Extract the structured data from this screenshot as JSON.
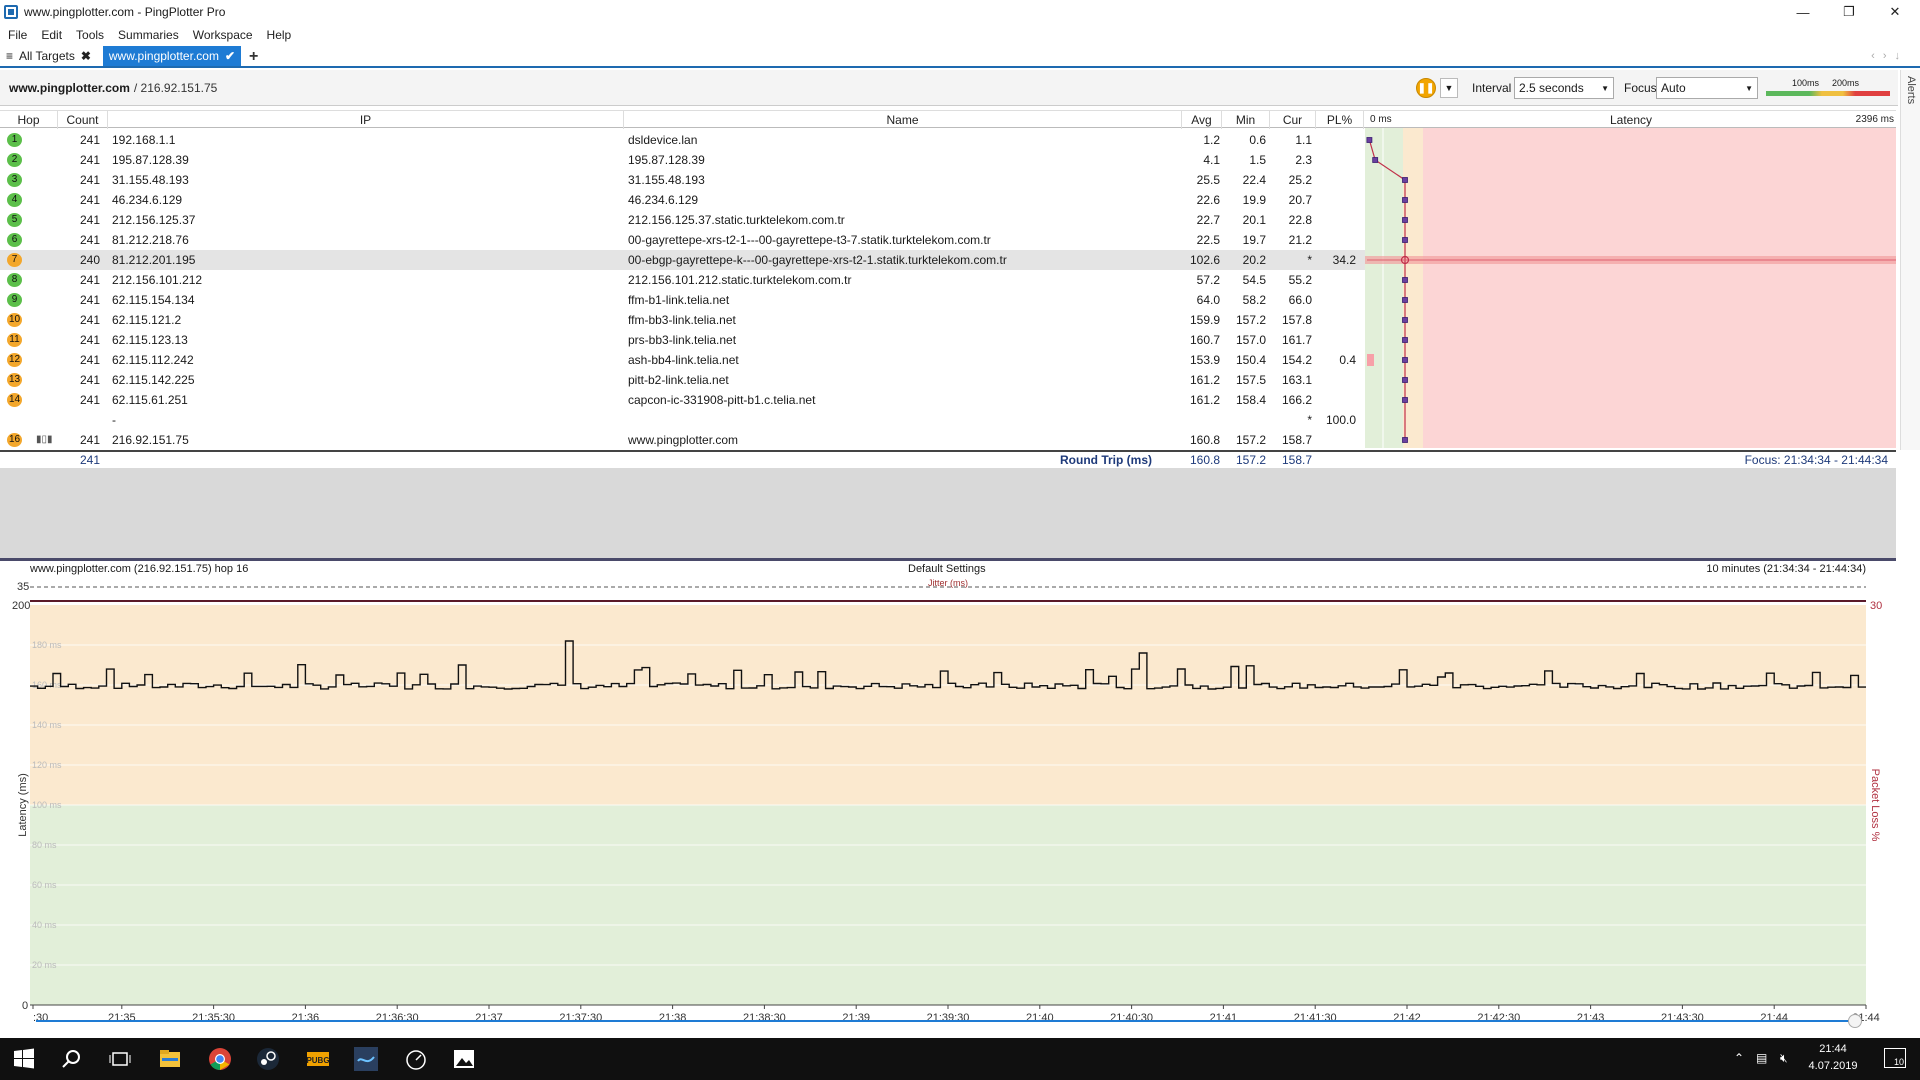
{
  "window": {
    "title": "www.pingplotter.com - PingPlotter Pro"
  },
  "menu": [
    "File",
    "Edit",
    "Tools",
    "Summaries",
    "Workspace",
    "Help"
  ],
  "tabs": {
    "all_targets": "All Targets",
    "active": "www.pingplotter.com"
  },
  "alerts": "Alerts",
  "target": {
    "host": "www.pingplotter.com",
    "ip": " / 216.92.151.75"
  },
  "toolbar": {
    "interval_label": "Interval",
    "interval_value": "2.5 seconds",
    "focus_label": "Focus",
    "focus_value": "Auto",
    "scale_100": "100ms",
    "scale_200": "200ms"
  },
  "grid": {
    "headers": {
      "hop": "Hop",
      "count": "Count",
      "ip": "IP",
      "name": "Name",
      "avg": "Avg",
      "min": "Min",
      "cur": "Cur",
      "pl": "PL%",
      "zero": "0 ms",
      "latency": "Latency",
      "max": "2396 ms"
    },
    "rows": [
      {
        "hop": "1",
        "count": "241",
        "ip": "192.168.1.1",
        "name": "dsldevice.lan",
        "avg": "1.2",
        "min": "0.6",
        "cur": "1.1",
        "pl": "",
        "color": "green",
        "lat": 1.2
      },
      {
        "hop": "2",
        "count": "241",
        "ip": "195.87.128.39",
        "name": "195.87.128.39",
        "avg": "4.1",
        "min": "1.5",
        "cur": "2.3",
        "pl": "",
        "color": "green",
        "lat": 4.1
      },
      {
        "hop": "3",
        "count": "241",
        "ip": "31.155.48.193",
        "name": "31.155.48.193",
        "avg": "25.5",
        "min": "22.4",
        "cur": "25.2",
        "pl": "",
        "color": "green",
        "lat": 25.5
      },
      {
        "hop": "4",
        "count": "241",
        "ip": "46.234.6.129",
        "name": "46.234.6.129",
        "avg": "22.6",
        "min": "19.9",
        "cur": "20.7",
        "pl": "",
        "color": "green",
        "lat": 22.6
      },
      {
        "hop": "5",
        "count": "241",
        "ip": "212.156.125.37",
        "name": "212.156.125.37.static.turktelekom.com.tr",
        "avg": "22.7",
        "min": "20.1",
        "cur": "22.8",
        "pl": "",
        "color": "green",
        "lat": 22.7
      },
      {
        "hop": "6",
        "count": "241",
        "ip": "81.212.218.76",
        "name": "00-gayrettepe-xrs-t2-1---00-gayrettepe-t3-7.statik.turktelekom.com.tr",
        "avg": "22.5",
        "min": "19.7",
        "cur": "21.2",
        "pl": "",
        "color": "green",
        "lat": 22.5
      },
      {
        "hop": "7",
        "count": "240",
        "ip": "81.212.201.195",
        "name": "00-ebgp-gayrettepe-k---00-gayrettepe-xrs-t2-1.statik.turktelekom.com.tr",
        "avg": "102.6",
        "min": "20.2",
        "cur": "*",
        "pl": "34.2",
        "color": "orange",
        "lat": 102.6,
        "selected": true
      },
      {
        "hop": "8",
        "count": "241",
        "ip": "212.156.101.212",
        "name": "212.156.101.212.static.turktelekom.com.tr",
        "avg": "57.2",
        "min": "54.5",
        "cur": "55.2",
        "pl": "",
        "color": "green",
        "lat": 57.2
      },
      {
        "hop": "9",
        "count": "241",
        "ip": "62.115.154.134",
        "name": "ffm-b1-link.telia.net",
        "avg": "64.0",
        "min": "58.2",
        "cur": "66.0",
        "pl": "",
        "color": "green",
        "lat": 64.0
      },
      {
        "hop": "10",
        "count": "241",
        "ip": "62.115.121.2",
        "name": "ffm-bb3-link.telia.net",
        "avg": "159.9",
        "min": "157.2",
        "cur": "157.8",
        "pl": "",
        "color": "orange",
        "lat": 159.9
      },
      {
        "hop": "11",
        "count": "241",
        "ip": "62.115.123.13",
        "name": "prs-bb3-link.telia.net",
        "avg": "160.7",
        "min": "157.0",
        "cur": "161.7",
        "pl": "",
        "color": "orange",
        "lat": 160.7
      },
      {
        "hop": "12",
        "count": "241",
        "ip": "62.115.112.242",
        "name": "ash-bb4-link.telia.net",
        "avg": "153.9",
        "min": "150.4",
        "cur": "154.2",
        "pl": "0.4",
        "color": "orange",
        "lat": 153.9
      },
      {
        "hop": "13",
        "count": "241",
        "ip": "62.115.142.225",
        "name": "pitt-b2-link.telia.net",
        "avg": "161.2",
        "min": "157.5",
        "cur": "163.1",
        "pl": "",
        "color": "orange",
        "lat": 161.2
      },
      {
        "hop": "14",
        "count": "241",
        "ip": "62.115.61.251",
        "name": "capcon-ic-331908-pitt-b1.c.telia.net",
        "avg": "161.2",
        "min": "158.4",
        "cur": "166.2",
        "pl": "",
        "color": "orange",
        "lat": 161.2
      },
      {
        "hop": "",
        "count": "",
        "ip": "-",
        "name": "",
        "avg": "",
        "min": "",
        "cur": "*",
        "pl": "100.0",
        "color": "none",
        "lat": null
      },
      {
        "hop": "16",
        "count": "241",
        "ip": "216.92.151.75",
        "name": "www.pingplotter.com",
        "avg": "160.8",
        "min": "157.2",
        "cur": "158.7",
        "pl": "",
        "color": "orange",
        "lat": 160.8,
        "graph_icon": true
      }
    ],
    "summary": {
      "count": "241",
      "label": "Round Trip (ms)",
      "avg": "160.8",
      "min": "157.2",
      "cur": "158.7",
      "focus": "Focus: 21:34:34 - 21:44:34"
    }
  },
  "timeline": {
    "target": "www.pingplotter.com (216.92.151.75) hop 16",
    "settings": "Default Settings",
    "range": "10 minutes (21:34:34 - 21:44:34)",
    "jitter_label": "Jitter (ms)",
    "jitter_max": "35",
    "y_label": "Latency (ms)",
    "pl_label": "Packet Loss %",
    "pl_max": "30",
    "y_top": "200",
    "y_zero": "0",
    "y_ticks": [
      "180 ms",
      "160 ms",
      "140 ms",
      "120 ms",
      "100 ms",
      "80 ms",
      "60 ms",
      "40 ms",
      "20 ms"
    ],
    "x_ticks": [
      ":30",
      "21:35",
      "21:35:30",
      "21:36",
      "21:36:30",
      "21:37",
      "21:37:30",
      "21:38",
      "21:38:30",
      "21:39",
      "21:39:30",
      "21:40",
      "21:40:30",
      "21:41",
      "21:41:30",
      "21:42",
      "21:42:30",
      "21:43",
      "21:43:30",
      "21:44",
      "21:44"
    ]
  },
  "taskbar": {
    "time": "21:44",
    "date": "4.07.2019",
    "notif": "10"
  },
  "colors": {
    "accent": "#1e7bd4",
    "green_zone": "#e2efd9",
    "yellow_zone": "#fbe9cf",
    "red_zone": "#fcd5d5",
    "hop_green": "#5cbf4a",
    "hop_orange": "#f3a72b"
  }
}
